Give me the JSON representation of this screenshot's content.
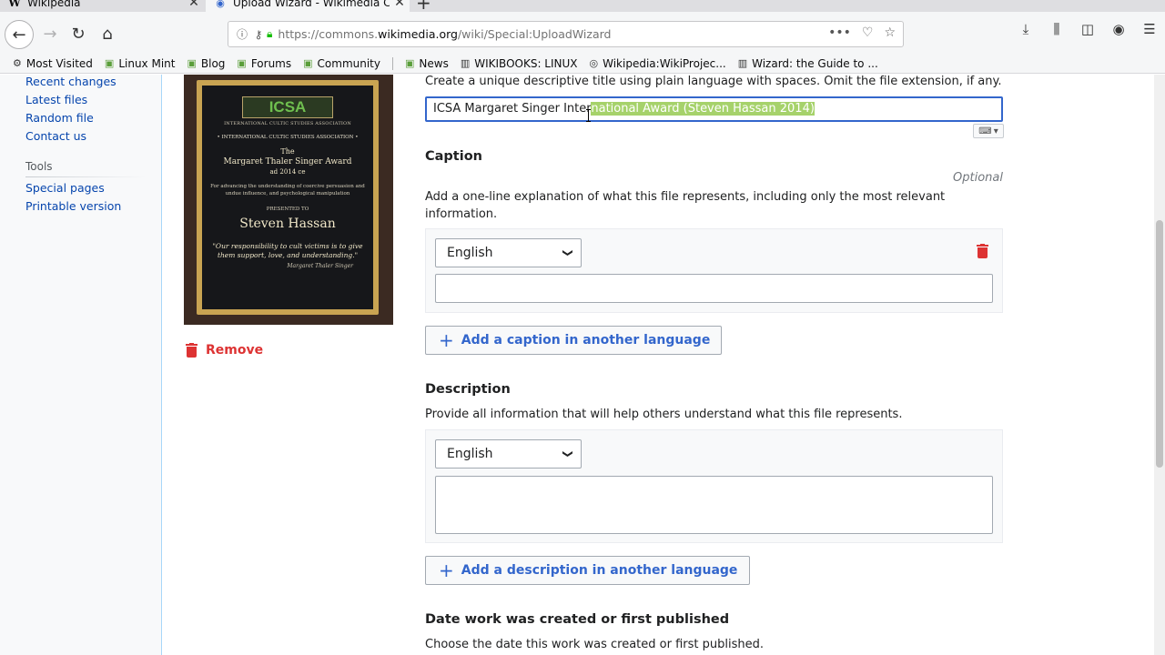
{
  "browser": {
    "tabs": [
      {
        "label": "Wikipedia",
        "favicon": "W"
      },
      {
        "label": "Upload Wizard - Wikimedia Co",
        "favicon": "commons"
      }
    ],
    "url": {
      "prefix": "https://commons.",
      "domain": "wikimedia.org",
      "path": "/wiki/Special:UploadWizard"
    },
    "bookmarks": [
      {
        "label": "Most Visited",
        "icon": "gear-icon"
      },
      {
        "label": "Linux Mint",
        "icon": "folder-icon"
      },
      {
        "label": "Blog",
        "icon": "folder-icon"
      },
      {
        "label": "Forums",
        "icon": "folder-icon"
      },
      {
        "label": "Community",
        "icon": "folder-icon"
      },
      {
        "label": "News",
        "icon": "folder-icon"
      },
      {
        "label": "WIKIBOOKS: LINUX",
        "icon": "wikibooks-icon"
      },
      {
        "label": "Wikipedia:WikiProjec...",
        "icon": "globe-icon"
      },
      {
        "label": "Wizard: the Guide to ...",
        "icon": "book-icon"
      }
    ]
  },
  "sidebar": {
    "links": [
      "Recent changes",
      "Latest files",
      "Random file",
      "Contact us"
    ],
    "tools_heading": "Tools",
    "tools": [
      "Special pages",
      "Printable version"
    ]
  },
  "thumbnail": {
    "logo": "ICSA",
    "small": "INTERNATIONAL CULTIC STUDIES ASSOCIATION",
    "org": "• INTERNATIONAL CULTIC STUDIES ASSOCIATION •",
    "the": "The",
    "award": "Margaret Thaler Singer Award",
    "year": "ad 2014 ce",
    "for": "For advancing the understanding of coercive persuasion and undue influence, and psychological manipulation",
    "presented": "PRESENTED TO",
    "name": "Steven Hassan",
    "quote": "\"Our responsibility to cult victims is to give them support, love, and understanding.\"",
    "signature": "Margaret Thaler Singer"
  },
  "remove_label": "Remove",
  "title_field": {
    "help": "Create a unique descriptive title using plain language with spaces. Omit the file extension, if any.",
    "value_before": "ICSA Margaret Singer Inter",
    "value_selected": "national Award (Steven Hassan 2014)"
  },
  "caption": {
    "heading": "Caption",
    "optional": "Optional",
    "help": "Add a one-line explanation of what this file represents, including only the most relevant information.",
    "language": "English",
    "value": "",
    "add_button": "Add a caption in another language"
  },
  "description": {
    "heading": "Description",
    "help": "Provide all information that will help others understand what this file represents.",
    "language": "English",
    "value": "",
    "add_button": "Add a description in another language"
  },
  "date": {
    "heading": "Date work was created or first published",
    "help": "Choose the date this work was created or first published."
  },
  "colors": {
    "link": "#0645ad",
    "progressive": "#3366cc",
    "destructive": "#dd3333",
    "selection": "#a6d26b"
  }
}
